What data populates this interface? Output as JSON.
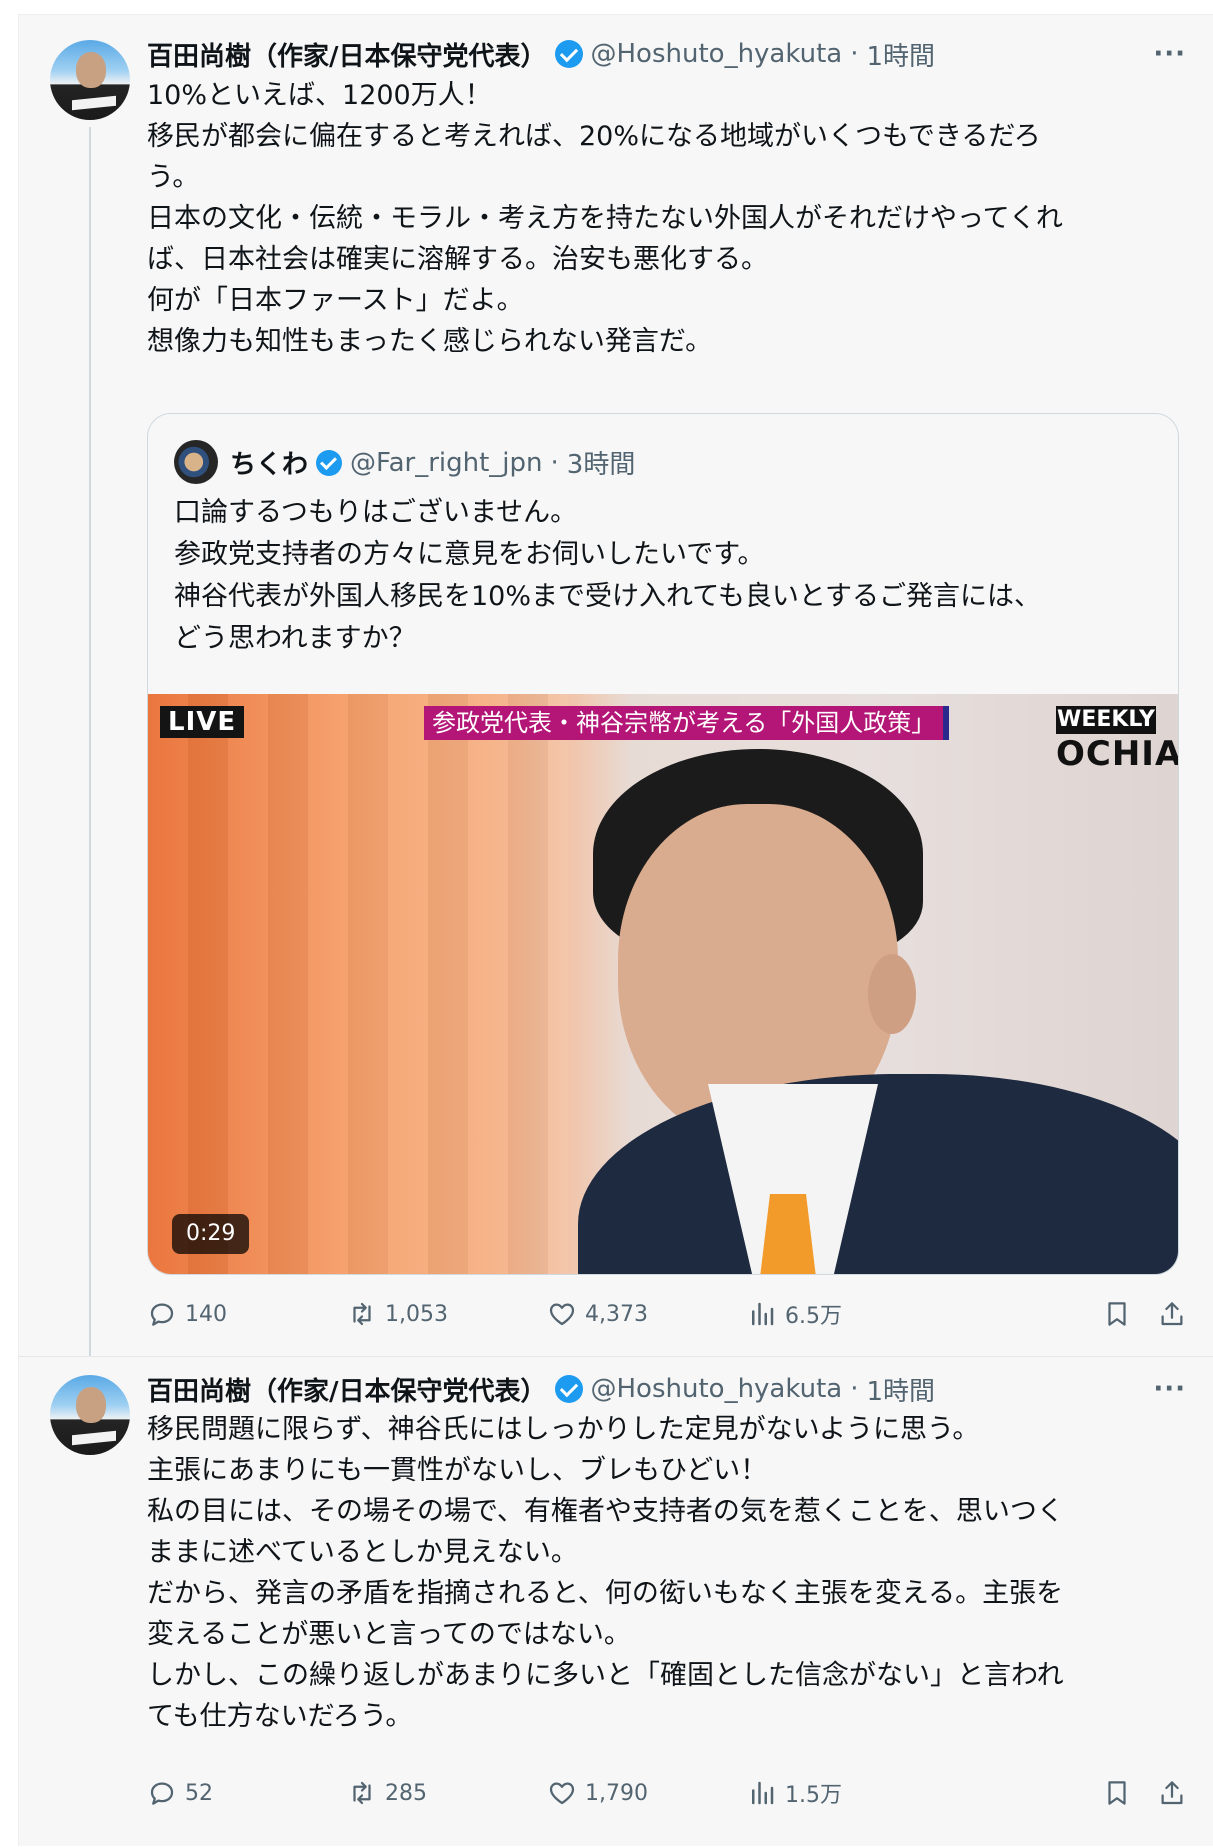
{
  "tweets": [
    {
      "display_name": "百田尚樹（作家/日本保守党代表）",
      "handle": "@Hoshuto_hyakuta",
      "separator": "·",
      "time": "1時間",
      "more": "···",
      "body": [
        "10%といえば、1200万人！",
        "移民が都会に偏在すると考えれば、20%になる地域がいくつもできるだろ",
        "う。",
        "日本の文化・伝統・モラル・考え方を持たない外国人がそれだけやってくれ",
        "ば、日本社会は確実に溶解する。治安も悪化する。",
        "何が「日本ファースト」だよ。",
        "想像力も知性もまったく感じられない発言だ。"
      ],
      "quote": {
        "display_name": "ちくわ",
        "handle": "@Far_right_jpn",
        "separator": "·",
        "time": "3時間",
        "body": [
          "口論するつもりはございません。",
          "参政党支持者の方々に意見をお伺いしたいです。",
          "神谷代表が外国人移民を10%まで受け入れても良いとするご発言には、",
          "どう思われますか？"
        ],
        "video": {
          "live_label": "LIVE",
          "caption": "参政党代表・神谷宗幣が考える「外国人政策」",
          "brand_top": "WEEKLY",
          "brand_bottom": "OCHIAI",
          "duration": "0:29"
        }
      },
      "metrics": {
        "replies": "140",
        "reposts": "1,053",
        "likes": "4,373",
        "views": "6.5万"
      }
    },
    {
      "display_name": "百田尚樹（作家/日本保守党代表）",
      "handle": "@Hoshuto_hyakuta",
      "separator": "·",
      "time": "1時間",
      "more": "···",
      "body": [
        "移民問題に限らず、神谷氏にはしっかりした定見がないように思う。",
        "主張にあまりにも一貫性がないし、ブレもひどい！",
        "私の目には、その場その場で、有権者や支持者の気を惹くことを、思いつく",
        "ままに述べているとしか見えない。",
        "だから、発言の矛盾を指摘されると、何の衒いもなく主張を変える。主張を",
        "変えることが悪いと言ってのではない。",
        "しかし、この繰り返しがあまりに多いと「確固とした信念がない」と言われ",
        "ても仕方ないだろう。"
      ],
      "metrics": {
        "replies": "52",
        "reposts": "285",
        "likes": "1,790",
        "views": "1.5万"
      }
    }
  ],
  "colors": {
    "verified": "#1d9bf0",
    "secondary_text": "#536471",
    "caption_bg": "#b41677"
  }
}
